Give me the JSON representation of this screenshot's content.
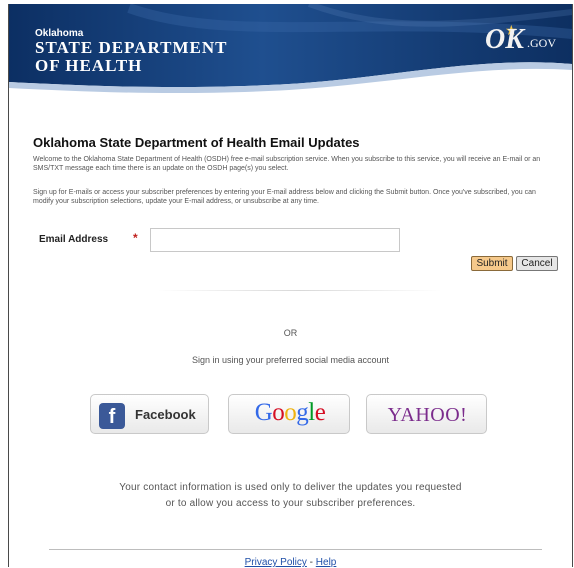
{
  "header": {
    "org_small": "Oklahoma",
    "org_line1": "STATE DEPARTMENT",
    "org_line2": "OF HEALTH",
    "portal_logo_ok": "OK",
    "portal_logo_gov": ".GOV",
    "colors": {
      "banner_dark": "#0c2f63",
      "banner_mid": "#1f4f8f",
      "wave": "#b9cbe3"
    }
  },
  "main": {
    "title": "Oklahoma State Department of Health Email Updates",
    "intro": "Welcome to the Oklahoma State Department of Health (OSDH) free e-mail subscription service. When you subscribe to this service, you will receive an E-mail or an SMS/TXT message each time there is an update on the OSDH page(s) you select.",
    "instructions": "Sign up for E-mails or access your subscriber preferences by entering your E-mail address below and clicking the Submit button. Once you've subscribed, you can modify your subscription selections, update your E-mail address, or unsubscribe at any time."
  },
  "form": {
    "email_label": "Email Address",
    "required_mark": "*",
    "email_value": "",
    "submit_label": "Submit",
    "cancel_label": "Cancel"
  },
  "social": {
    "or_text": "OR",
    "prompt": "Sign in using your preferred social media account",
    "facebook_icon_letter": "f",
    "facebook_label": "Facebook",
    "google_label": "Google",
    "yahoo_label": "YAHOO!"
  },
  "notice": {
    "line1": "Your contact information is used only to deliver the updates you requested",
    "line2": "or to allow you access to your subscriber preferences."
  },
  "footer": {
    "privacy_link": "Privacy Policy",
    "separator": "-",
    "help_link": "Help"
  }
}
